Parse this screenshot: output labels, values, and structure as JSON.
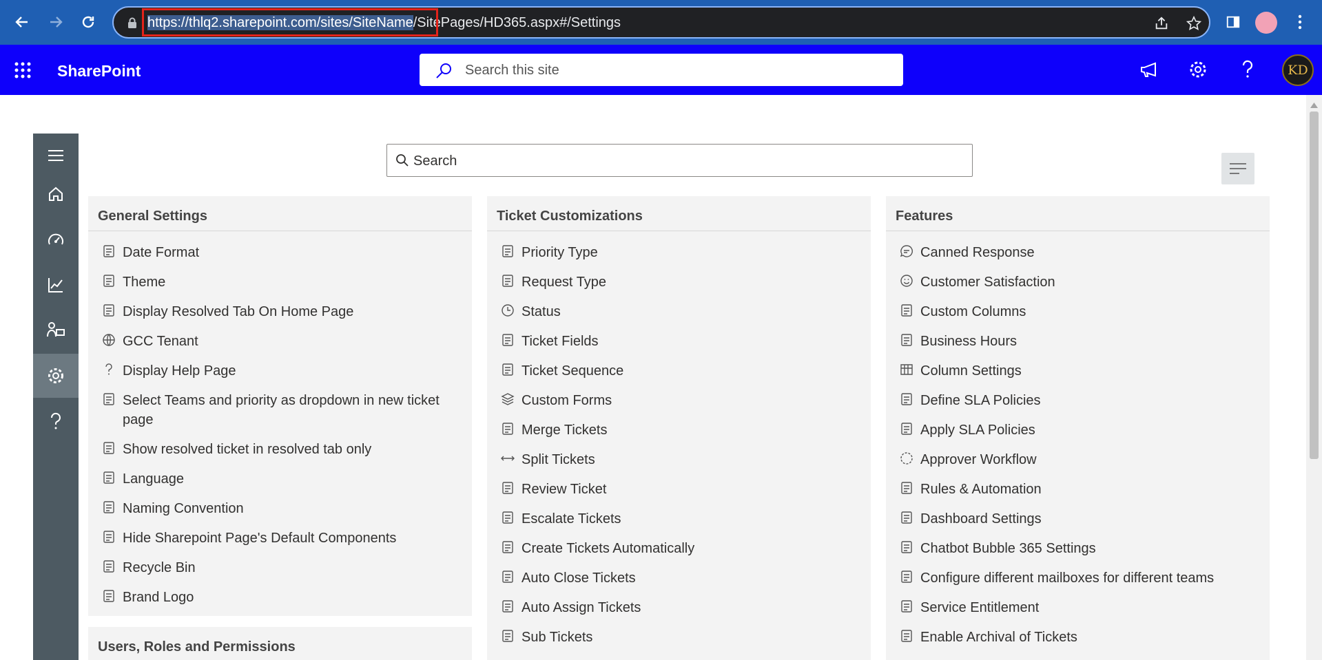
{
  "browser": {
    "url_selected": "https://thlq2.sharepoint.com/sites/SiteName",
    "url_rest": "/SitePages/HD365.aspx#/Settings"
  },
  "suitebar": {
    "brand": "SharePoint",
    "search_placeholder": "Search this site",
    "avatar_initials": "KD"
  },
  "main": {
    "search_placeholder": "Search"
  },
  "general_settings": {
    "title": "General Settings",
    "items": [
      {
        "label": "Date Format",
        "icon": "calendar-clock-icon"
      },
      {
        "label": "Theme",
        "icon": "palette-icon"
      },
      {
        "label": "Display Resolved Tab On Home Page",
        "icon": "document-icon"
      },
      {
        "label": "GCC Tenant",
        "icon": "globe-icon"
      },
      {
        "label": "Display Help Page",
        "icon": "question-icon"
      },
      {
        "label": "Select Teams and priority as dropdown in new ticket page",
        "icon": "dropdown-icon"
      },
      {
        "label": "Show resolved ticket in resolved tab only",
        "icon": "document-icon"
      },
      {
        "label": "Language",
        "icon": "translate-icon"
      },
      {
        "label": "Naming Convention",
        "icon": "rename-icon"
      },
      {
        "label": "Hide Sharepoint Page's Default Components",
        "icon": "window-icon"
      },
      {
        "label": "Recycle Bin",
        "icon": "recycle-bin-icon"
      },
      {
        "label": "Brand Logo",
        "icon": "badge-check-icon"
      }
    ]
  },
  "users_roles": {
    "title": "Users, Roles and Permissions"
  },
  "ticket_customizations": {
    "title": "Ticket Customizations",
    "items": [
      {
        "label": "Priority Type",
        "icon": "checklist-icon"
      },
      {
        "label": "Request Type",
        "icon": "page-edit-icon"
      },
      {
        "label": "Status",
        "icon": "clock-icon"
      },
      {
        "label": "Ticket Fields",
        "icon": "ticket-icon"
      },
      {
        "label": "Ticket Sequence",
        "icon": "number-sequence-icon"
      },
      {
        "label": "Custom Forms",
        "icon": "layers-icon"
      },
      {
        "label": "Merge Tickets",
        "icon": "merge-icon"
      },
      {
        "label": "Split Tickets",
        "icon": "split-icon"
      },
      {
        "label": "Review Ticket",
        "icon": "people-review-icon"
      },
      {
        "label": "Escalate Tickets",
        "icon": "escalate-chart-icon"
      },
      {
        "label": "Create Tickets Automatically",
        "icon": "mail-ticket-icon"
      },
      {
        "label": "Auto Close Tickets",
        "icon": "auto-close-icon"
      },
      {
        "label": "Auto Assign Tickets",
        "icon": "clipboard-assign-icon"
      },
      {
        "label": "Sub Tickets",
        "icon": "sub-ticket-icon"
      }
    ]
  },
  "features": {
    "title": "Features",
    "items": [
      {
        "label": "Canned Response",
        "icon": "chat-icon"
      },
      {
        "label": "Customer Satisfaction",
        "icon": "smiley-icon"
      },
      {
        "label": "Custom Columns",
        "icon": "document-icon"
      },
      {
        "label": "Business Hours",
        "icon": "briefcase-icon"
      },
      {
        "label": "Column Settings",
        "icon": "grid-columns-icon"
      },
      {
        "label": "Define SLA Policies",
        "icon": "sla-icon"
      },
      {
        "label": "Apply SLA Policies",
        "icon": "sla-icon"
      },
      {
        "label": "Approver Workflow",
        "icon": "workflow-icon"
      },
      {
        "label": "Rules & Automation",
        "icon": "clipboard-rules-icon"
      },
      {
        "label": "Dashboard Settings",
        "icon": "gauge-icon"
      },
      {
        "label": "Chatbot Bubble 365 Settings",
        "icon": "bot-icon"
      },
      {
        "label": "Configure different mailboxes for different teams",
        "icon": "mailbox-icon"
      },
      {
        "label": "Service Entitlement",
        "icon": "mail-service-icon"
      },
      {
        "label": "Enable Archival of Tickets",
        "icon": "archive-icon"
      }
    ]
  },
  "colors": {
    "chrome": "#1f5fb3",
    "suitebar": "#0e00fb",
    "leftnav": "#4d5a62",
    "card": "#f3f3f3",
    "highlight": "#e2231a"
  }
}
